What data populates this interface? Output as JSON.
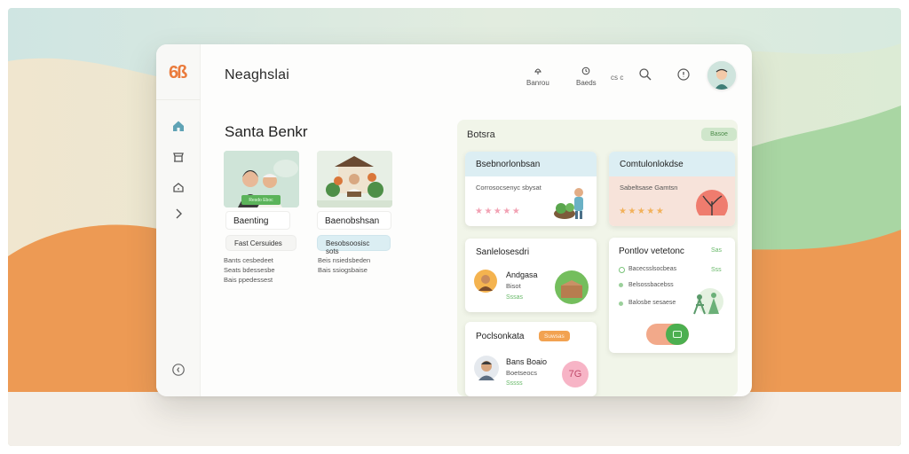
{
  "colors": {
    "accent_orange": "#ea7b3c",
    "accent_green": "#5bb35a",
    "bg_orange": "#ed9a54",
    "bg_mint": "#cde6e0"
  },
  "sidebar": {
    "logo": "6ß",
    "icons": [
      "home-icon",
      "store-icon",
      "home-outline-icon",
      "chevron-right-icon",
      "info-icon"
    ]
  },
  "header": {
    "title": "Neaghslai",
    "nav": [
      {
        "label": "Banrou",
        "icon": "lamp-icon"
      },
      {
        "label": "Baeds",
        "icon": "clock-icon"
      }
    ],
    "small_label": "ᴄꜱ ᴄ",
    "search_icon": "search-icon",
    "help_icon": "question-icon",
    "avatar": "user-avatar"
  },
  "main": {
    "section_title": "Santa Benkr",
    "tiles": [
      {
        "tag": "Resdo Eboc",
        "name": "Baenting",
        "chip": "Fast Cersuides",
        "desc": [
          "Bants cesbedeet",
          "Seats bdessesbe",
          "Bais ppedessest"
        ],
        "chip_color": "#f5f5f3"
      },
      {
        "tag": "",
        "name": "Baenobshsan",
        "chip": "Besobsoosisc sots",
        "desc": [
          "Beis nsiedsbeden",
          "Bais ssiogsbaise"
        ],
        "chip_color": "#dbeef3"
      }
    ]
  },
  "panel": {
    "title": "Botsra",
    "chip": "Basoe",
    "cards": [
      {
        "title": "Bsebnorlonbsan",
        "sub": "Corrosocsenyc sbysat",
        "stars": "★★★★★",
        "head_color": "#dceef3"
      },
      {
        "title": "Comtulonlokdse",
        "sub": "Sabeltsase Gamtsn",
        "stars": "★★★★★",
        "head_color": "#f7e1d8"
      },
      {
        "title": "Sanlelosesdri",
        "name": "Andgasa",
        "sub": "Bisot",
        "meta": "Sssas"
      },
      {
        "title": "Pontlov vetetonc",
        "badge": "Sas",
        "meta": "Sss",
        "items": [
          "Bacecsslsocbeas",
          "Belsossbacebss",
          "Balosbe sesaese"
        ]
      },
      {
        "title": "Poclsonkata",
        "badge": "Suwsas",
        "name": "Bans Boaio",
        "sub": "Boetseocs",
        "meta": "Sssss",
        "avatar_text": "7G"
      }
    ]
  }
}
